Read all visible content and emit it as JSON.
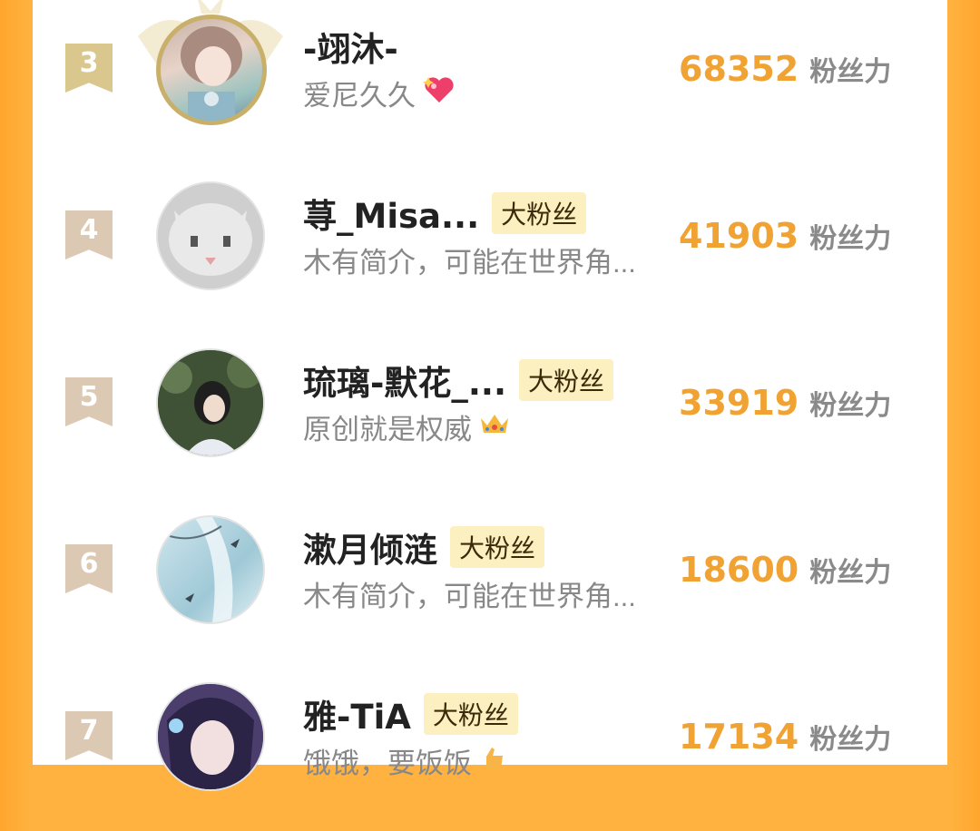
{
  "rows": [
    {
      "rank": "3",
      "name": "-翊沐-",
      "badge": "",
      "intro": "爱尼久久",
      "emoji": "heart-emoji",
      "score": "68352",
      "unit": "粉丝力"
    },
    {
      "rank": "4",
      "name": "荨_Misa...",
      "badge": "大粉丝",
      "intro": "木有简介，可能在世界角...",
      "emoji": "",
      "score": "41903",
      "unit": "粉丝力"
    },
    {
      "rank": "5",
      "name": "琉璃-默花_...",
      "badge": "大粉丝",
      "intro": "原创就是权威",
      "emoji": "crown-emoji",
      "score": "33919",
      "unit": "粉丝力"
    },
    {
      "rank": "6",
      "name": "漱月倾涟",
      "badge": "大粉丝",
      "intro": "木有简介，可能在世界角...",
      "emoji": "",
      "score": "18600",
      "unit": "粉丝力"
    },
    {
      "rank": "7",
      "name": "雅-TiA",
      "badge": "大粉丝",
      "intro": "饿饿，要饭饭",
      "emoji": "hand-emoji",
      "score": "17134",
      "unit": "粉丝力"
    }
  ],
  "colors": {
    "accent": "#f0a232",
    "frame": "#ffb23f",
    "badge_bg": "#fdf0c0",
    "rank_gold": "#d9c78e",
    "rank_default": "#dcc9b3"
  }
}
